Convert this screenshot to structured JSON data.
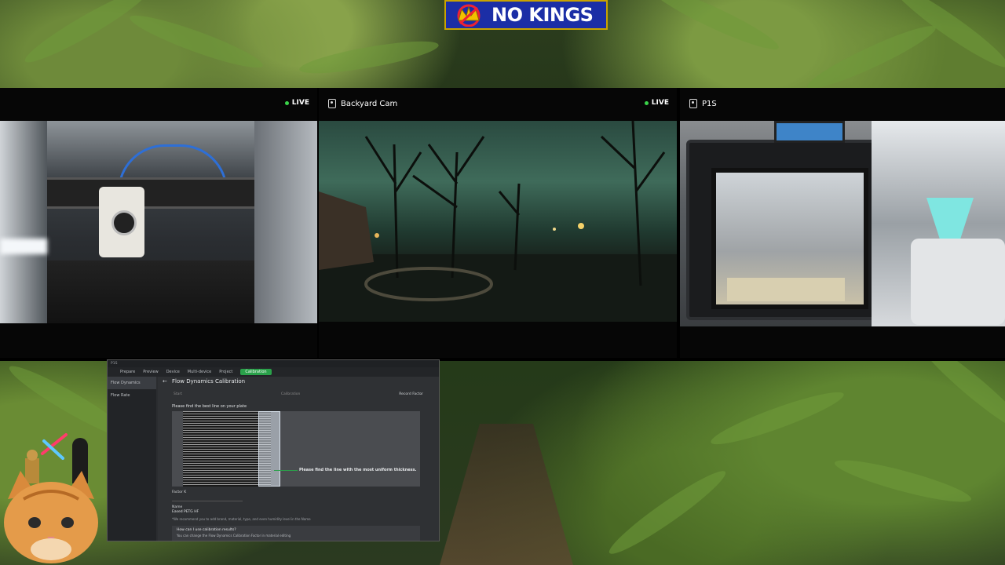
{
  "logo": {
    "text": "NO KINGS"
  },
  "cams": {
    "cam1": {
      "live": "LIVE"
    },
    "cam2": {
      "title": "Backyard Cam",
      "live": "LIVE"
    },
    "cam3": {
      "title": "P1S"
    }
  },
  "app": {
    "titlebar": "P1S",
    "nav": [
      "Prepare",
      "Preview",
      "Device",
      "Multi-device",
      "Project",
      "Calibration"
    ],
    "sidebar": [
      "Flow Dynamics",
      "Flow Rate"
    ],
    "title": "Flow Dynamics Calibration",
    "steps": {
      "left": "Start",
      "middle": "Calibration",
      "right": "Record Factor"
    },
    "prompt": "Please find the best line on your plate",
    "hint": "Please find the line with the most uniform thickness.",
    "factor_label": "Factor K",
    "name_label": "Name",
    "name_value": "Eased PETG HF",
    "note": "*We recommend you to add brand, material, type, and even humidity level in the Name",
    "faq_q": "How can I use calibration results?",
    "faq_a": "You can change the Flow Dynamics Calibration Factor in material editing"
  },
  "colors": {
    "logo_bg": "#1b2ea6",
    "live_dot": "#3ad34a",
    "accent": "#2aa14a"
  }
}
